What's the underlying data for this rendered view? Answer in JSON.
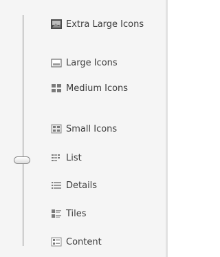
{
  "view_menu": {
    "items": [
      {
        "label": "Extra Large Icons",
        "icon": "extra-large-icons-icon"
      },
      {
        "label": "Large Icons",
        "icon": "large-icons-icon"
      },
      {
        "label": "Medium Icons",
        "icon": "medium-icons-icon"
      },
      {
        "label": "Small Icons",
        "icon": "small-icons-icon"
      },
      {
        "label": "List",
        "icon": "list-view-icon"
      },
      {
        "label": "Details",
        "icon": "details-view-icon"
      },
      {
        "label": "Tiles",
        "icon": "tiles-view-icon"
      },
      {
        "label": "Content",
        "icon": "content-view-icon"
      }
    ],
    "selected": "List"
  }
}
